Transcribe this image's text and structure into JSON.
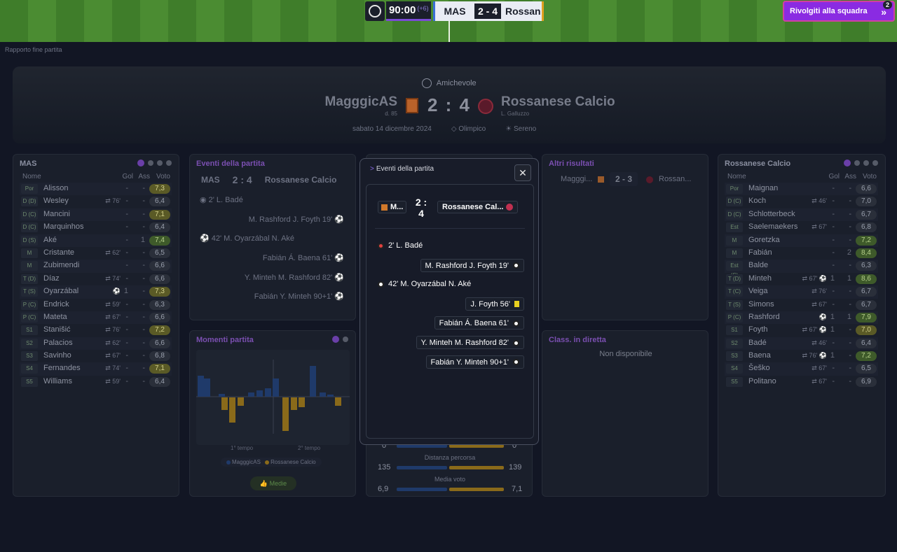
{
  "topbar": {
    "time": "90:00",
    "added": "(+6)",
    "home_short": "MAS",
    "score": "2 - 4",
    "away_short": "Rossan",
    "team_talk": "Rivolgiti alla squadra",
    "notif_count": "2"
  },
  "breadcrumb": "Rapporto fine partita",
  "header": {
    "competition": "Amichevole",
    "home_name": "MagggicAS",
    "home_sub": "d. 85",
    "score": "2 : 4",
    "away_name": "Rossanese Calcio",
    "away_sub": "L. Galluzzo",
    "date": "sabato 14 dicembre 2024",
    "stadium": "Olimpico",
    "weather": "Sereno"
  },
  "home_lineup": {
    "title": "MAS",
    "cols": [
      "Nome",
      "Gol",
      "Ass",
      "Voto"
    ],
    "players": [
      {
        "pos": "Por",
        "name": "Alisson",
        "ev": "",
        "gol": "-",
        "ass": "-",
        "voto": "7,3",
        "tone": "y"
      },
      {
        "pos": "D (D)",
        "name": "Wesley",
        "ev": "⇄ 76'",
        "gol": "-",
        "ass": "-",
        "voto": "6,4",
        "tone": ""
      },
      {
        "pos": "D (C)",
        "name": "Mancini",
        "ev": "",
        "gol": "-",
        "ass": "-",
        "voto": "7,1",
        "tone": "y"
      },
      {
        "pos": "D (C)",
        "name": "Marquinhos",
        "ev": "",
        "gol": "-",
        "ass": "-",
        "voto": "6,4",
        "tone": ""
      },
      {
        "pos": "D (S)",
        "name": "Aké",
        "ev": "",
        "gol": "-",
        "ass": "1",
        "voto": "7,4",
        "tone": "g"
      },
      {
        "pos": "M",
        "name": "Cristante",
        "ev": "⇄ 62'",
        "gol": "-",
        "ass": "-",
        "voto": "6,5",
        "tone": ""
      },
      {
        "pos": "M",
        "name": "Zubimendi",
        "ev": "",
        "gol": "-",
        "ass": "-",
        "voto": "6,6",
        "tone": ""
      },
      {
        "pos": "T (D)",
        "name": "Díaz",
        "ev": "⇄ 74'",
        "gol": "-",
        "ass": "-",
        "voto": "6,6",
        "tone": ""
      },
      {
        "pos": "T (S)",
        "name": "Oyarzábal",
        "ev": "⚽",
        "gol": "1",
        "ass": "-",
        "voto": "7,3",
        "tone": "y"
      },
      {
        "pos": "P (C)",
        "name": "Endrick",
        "ev": "⇄ 59'",
        "gol": "-",
        "ass": "-",
        "voto": "6,3",
        "tone": ""
      },
      {
        "pos": "P (C)",
        "name": "Mateta",
        "ev": "⇄ 67'",
        "gol": "-",
        "ass": "-",
        "voto": "6,6",
        "tone": ""
      },
      {
        "pos": "S1",
        "name": "Stanišić",
        "ev": "⇄ 76'",
        "gol": "-",
        "ass": "-",
        "voto": "7,2",
        "tone": "y"
      },
      {
        "pos": "S2",
        "name": "Palacios",
        "ev": "⇄ 62'",
        "gol": "-",
        "ass": "-",
        "voto": "6,6",
        "tone": ""
      },
      {
        "pos": "S3",
        "name": "Savinho",
        "ev": "⇄ 67'",
        "gol": "-",
        "ass": "-",
        "voto": "6,8",
        "tone": ""
      },
      {
        "pos": "S4",
        "name": "Fernandes",
        "ev": "⇄ 74'",
        "gol": "-",
        "ass": "-",
        "voto": "7,1",
        "tone": "y"
      },
      {
        "pos": "S5",
        "name": "Williams",
        "ev": "⇄ 59'",
        "gol": "-",
        "ass": "-",
        "voto": "6,4",
        "tone": ""
      }
    ]
  },
  "away_lineup": {
    "title": "Rossanese Calcio",
    "cols": [
      "Nome",
      "Gol",
      "Ass",
      "Voto"
    ],
    "players": [
      {
        "pos": "Por",
        "name": "Maignan",
        "ev": "",
        "gol": "-",
        "ass": "-",
        "voto": "6,6",
        "tone": ""
      },
      {
        "pos": "D (C)",
        "name": "Koch",
        "ev": "⇄ 46'",
        "gol": "-",
        "ass": "-",
        "voto": "7,0",
        "tone": ""
      },
      {
        "pos": "D (C)",
        "name": "Schlotterbeck",
        "ev": "",
        "gol": "-",
        "ass": "-",
        "voto": "6,7",
        "tone": ""
      },
      {
        "pos": "Est (D)",
        "name": "Saelemaekers",
        "ev": "⇄ 67'",
        "gol": "-",
        "ass": "-",
        "voto": "6,8",
        "tone": ""
      },
      {
        "pos": "M",
        "name": "Goretzka",
        "ev": "",
        "gol": "-",
        "ass": "-",
        "voto": "7,2",
        "tone": "g"
      },
      {
        "pos": "M",
        "name": "Fabián",
        "ev": "",
        "gol": "-",
        "ass": "2",
        "voto": "8,4",
        "tone": "g"
      },
      {
        "pos": "Est (S)",
        "name": "Balde",
        "ev": "",
        "gol": "-",
        "ass": "-",
        "voto": "6,3",
        "tone": ""
      },
      {
        "pos": "T (D)",
        "name": "Minteh",
        "ev": "⇄ 67' ⚽",
        "gol": "1",
        "ass": "1",
        "voto": "8,6",
        "tone": "g"
      },
      {
        "pos": "T (C)",
        "name": "Veiga",
        "ev": "⇄ 76'",
        "gol": "-",
        "ass": "-",
        "voto": "6,7",
        "tone": ""
      },
      {
        "pos": "T (S)",
        "name": "Simons",
        "ev": "⇄ 67'",
        "gol": "-",
        "ass": "-",
        "voto": "6,7",
        "tone": ""
      },
      {
        "pos": "P (C)",
        "name": "Rashford",
        "ev": "⚽",
        "gol": "1",
        "ass": "1",
        "voto": "7,9",
        "tone": "g"
      },
      {
        "pos": "S1",
        "name": "Foyth",
        "ev": "⇄ 67' ⚽",
        "gol": "1",
        "ass": "-",
        "voto": "7,0",
        "tone": "y"
      },
      {
        "pos": "S2",
        "name": "Badé",
        "ev": "⇄ 46'",
        "gol": "-",
        "ass": "-",
        "voto": "6,4",
        "tone": ""
      },
      {
        "pos": "S3",
        "name": "Baena",
        "ev": "⇄ 76' ⚽",
        "gol": "1",
        "ass": "-",
        "voto": "7,2",
        "tone": "g"
      },
      {
        "pos": "S4",
        "name": "Šeško",
        "ev": "⇄ 67'",
        "gol": "-",
        "ass": "-",
        "voto": "6,5",
        "tone": ""
      },
      {
        "pos": "S5",
        "name": "Politano",
        "ev": "⇄ 67'",
        "gol": "-",
        "ass": "-",
        "voto": "6,9",
        "tone": ""
      }
    ]
  },
  "events_panel": {
    "title": "Eventi della partita",
    "home": "MAS",
    "score": "2 : 4",
    "away": "Rossanese Calcio",
    "events": [
      "2' L. Badé",
      "M. Rashford J. Foyth 19'",
      "42' M. Oyarzábal N. Aké",
      "Fabián Á. Baena 61'",
      "Y. Minteh M. Rashford 82'",
      "Fabián Y. Minteh 90+1'"
    ]
  },
  "momenti": {
    "title": "Momenti partita",
    "first_half": "1° tempo",
    "second_half": "2° tempo",
    "legend_home": "MagggicAS",
    "legend_away": "Rossanese Calcio",
    "medie": "Medie",
    "home_color": "#1f3a6a",
    "away_color": "#8a6a1a"
  },
  "stats": {
    "row0_left": "0",
    "row0_right": "0",
    "dist_label": "Distanza percorsa",
    "dist_left": "135",
    "dist_right": "139",
    "avg_label": "Media voto",
    "avg_left": "6,9",
    "avg_right": "7,1"
  },
  "altri": {
    "title": "Altri risultati",
    "home": "Magggi...",
    "score": "2 - 3",
    "away": "Rossan..."
  },
  "classifica": {
    "title": "Class. in diretta",
    "empty": "Non disponibile"
  },
  "modal": {
    "title": "Eventi della partita",
    "home": "M...",
    "score": "2 : 4",
    "away": "Rossanese Cal...",
    "close": "✕",
    "events": [
      {
        "text": "2' L. Badé",
        "side": "left",
        "icon": "own"
      },
      {
        "text": "M. Rashford J. Foyth 19'",
        "side": "right",
        "icon": "ball"
      },
      {
        "text": "42' M. Oyarzábal N. Aké",
        "side": "left",
        "icon": "ball"
      },
      {
        "text": "J. Foyth 56'",
        "side": "right",
        "icon": "card"
      },
      {
        "text": "Fabián Á. Baena 61'",
        "side": "right",
        "icon": "ball"
      },
      {
        "text": "Y. Minteh M. Rashford 82'",
        "side": "right",
        "icon": "ball"
      },
      {
        "text": "Fabián Y. Minteh 90+1'",
        "side": "right",
        "icon": "ball"
      }
    ]
  }
}
